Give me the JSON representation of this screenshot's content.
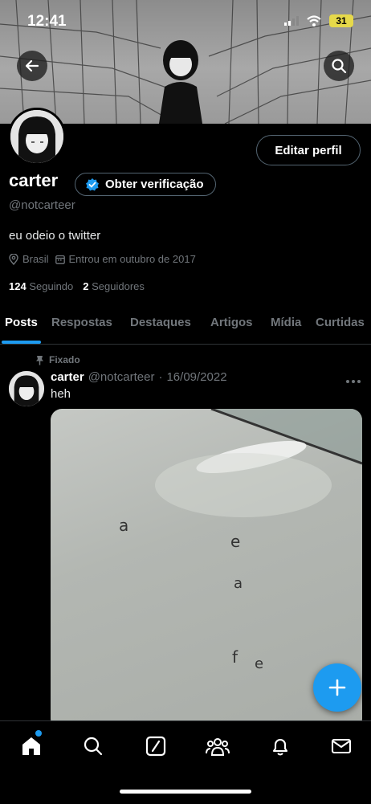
{
  "status_bar": {
    "time": "12:41",
    "battery": "31"
  },
  "profile": {
    "name": "carter",
    "verify_label": "Obter verificação",
    "handle": "@notcarteer",
    "bio": "eu odeio o twitter",
    "location": "Brasil",
    "joined": "Entrou em outubro de 2017",
    "following_count": "124",
    "following_label": "Seguindo",
    "followers_count": "2",
    "followers_label": "Seguidores",
    "edit_label": "Editar perfil"
  },
  "tabs": [
    "Posts",
    "Respostas",
    "Destaques",
    "Artigos",
    "Mídia",
    "Curtidas"
  ],
  "active_tab": "Posts",
  "pinned_post": {
    "pinned_label": "Fixado",
    "author": "carter",
    "handle": "@notcarteer",
    "sep": "·",
    "date": "16/09/2022",
    "text": "heh",
    "media_letters": [
      "a",
      "e",
      "a",
      "f",
      "e"
    ]
  },
  "colors": {
    "accent": "#1d9bf0",
    "background": "#000000",
    "muted": "#71767b",
    "battery": "#e6d94a"
  },
  "icons": [
    "back-arrow-icon",
    "search-icon",
    "verified-badge-icon",
    "location-pin-icon",
    "calendar-icon",
    "pin-icon",
    "more-icon",
    "compose-plus-icon",
    "home-icon",
    "explore-search-icon",
    "grok-icon",
    "communities-icon",
    "notifications-bell-icon",
    "messages-mail-icon"
  ]
}
